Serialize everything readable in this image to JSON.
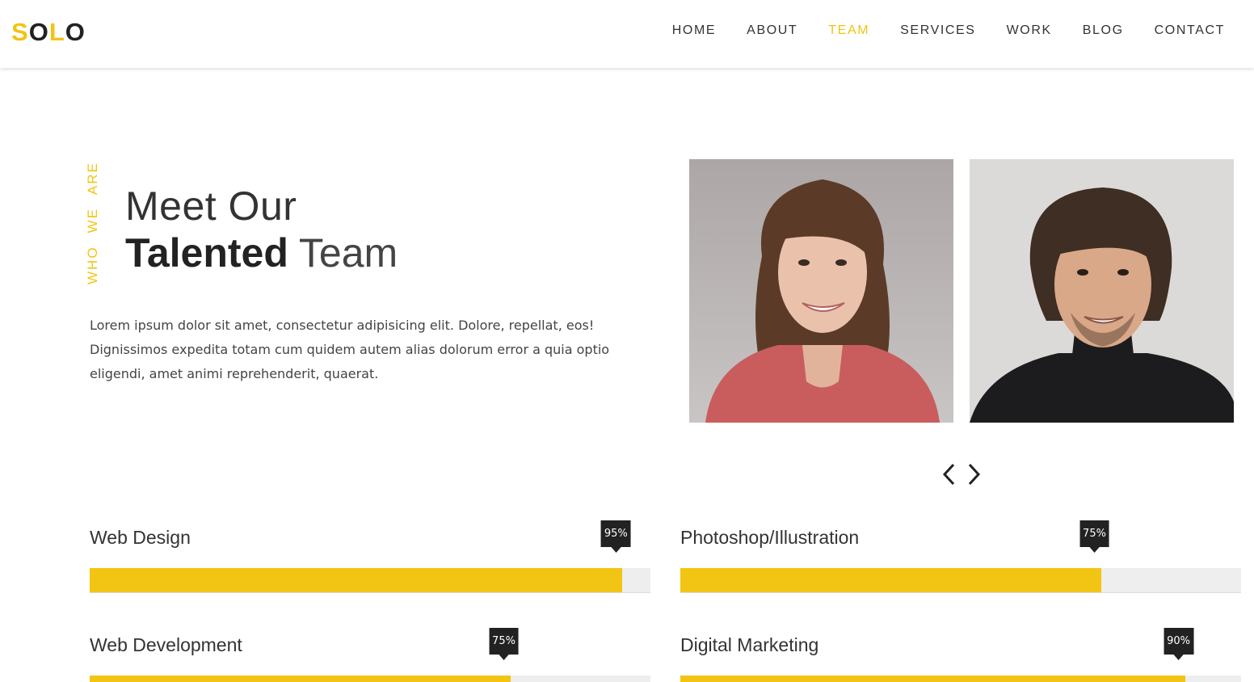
{
  "brand": {
    "logo_parts": [
      "S",
      "O",
      "L",
      "O"
    ]
  },
  "nav": {
    "items": [
      "HOME",
      "ABOUT",
      "TEAM",
      "SERVICES",
      "WORK",
      "BLOG",
      "CONTACT"
    ],
    "active": "TEAM"
  },
  "intro": {
    "vertical_words": [
      "WHO",
      "WE",
      "ARE"
    ],
    "title_line1": "Meet Our",
    "title_bold": "Talented",
    "title_thin": "Team",
    "paragraph": "Lorem ipsum dolor sit amet, consectetur adipisicing elit. Dolore, repellat, eos! Dignissimos expedita totam cum quidem autem alias dolorum error a quia optio eligendi, amet animi reprehenderit, quaerat."
  },
  "carousel": {
    "prev_icon": "chevron-left-icon",
    "next_icon": "chevron-right-icon"
  },
  "skills": [
    {
      "label": "Web Design",
      "percent": 95,
      "percent_text": "95%"
    },
    {
      "label": "Photoshop/Illustration",
      "percent": 75,
      "percent_text": "75%"
    },
    {
      "label": "Web Development",
      "percent": 75,
      "percent_text": "75%"
    },
    {
      "label": "Digital Marketing",
      "percent": 90,
      "percent_text": "90%"
    }
  ],
  "colors": {
    "accent": "#f2c413",
    "dark": "#222222",
    "track": "#eeeeee"
  }
}
